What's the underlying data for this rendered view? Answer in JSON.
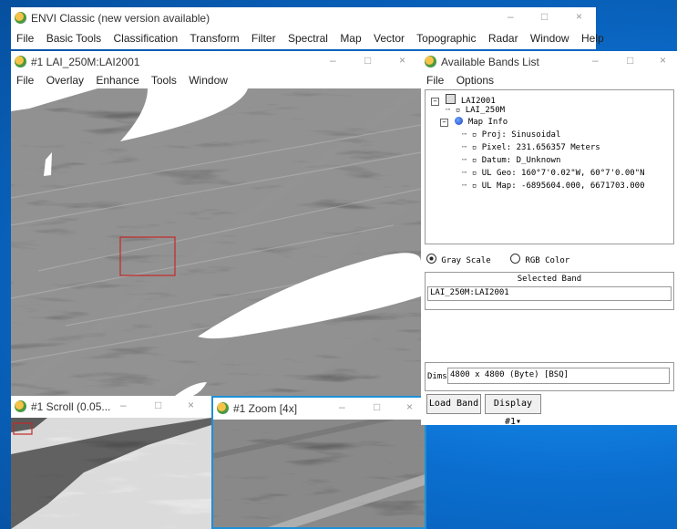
{
  "main_window": {
    "title": "ENVI Classic (new version available)",
    "menu": [
      "File",
      "Basic Tools",
      "Classification",
      "Transform",
      "Filter",
      "Spectral",
      "Map",
      "Vector",
      "Topographic",
      "Radar",
      "Window",
      "Help"
    ]
  },
  "image_window": {
    "title": "#1 LAI_250M:LAI2001",
    "menu": [
      "File",
      "Overlay",
      "Enhance",
      "Tools",
      "Window"
    ]
  },
  "scroll_window": {
    "title": "#1 Scroll (0.05..."
  },
  "zoom_window": {
    "title": "#1 Zoom [4x]"
  },
  "bands_window": {
    "title": "Available Bands List",
    "menu": [
      "File",
      "Options"
    ],
    "tree": {
      "root": "LAI2001",
      "band": "LAI_250M",
      "map_info": "Map Info",
      "items": [
        "Proj: Sinusoidal",
        "Pixel: 231.656357 Meters",
        "Datum: D_Unknown",
        "UL Geo: 160°7'0.02\"W, 60°7'0.00\"N",
        "UL Map: -6895604.000, 6671703.000"
      ]
    },
    "radio_gray": "Gray Scale",
    "radio_rgb": "RGB Color",
    "selected_band_header": "Selected Band",
    "selected_band_value": "LAI_250M:LAI2001",
    "dims_label": "Dims",
    "dims_value": "4800 x 4800 (Byte) [BSQ]",
    "load_band_button": "Load Band",
    "display_button": "Display #1▾"
  },
  "window_controls": {
    "minimize": "–",
    "maximize": "□",
    "close": "×"
  }
}
